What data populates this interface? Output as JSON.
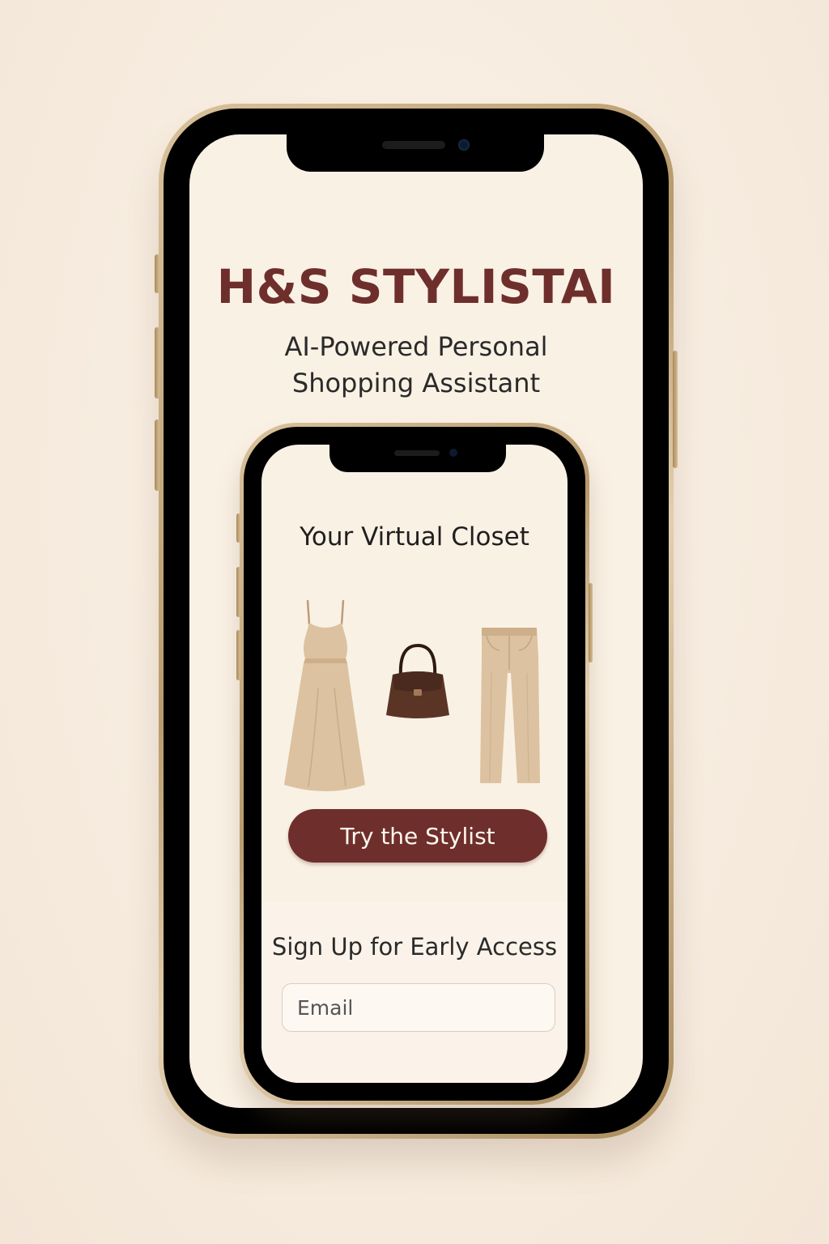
{
  "app": {
    "brand_title": "H&S STYLISTAI",
    "subtitle_line1": "AI-Powered Personal",
    "subtitle_line2": "Shopping Assistant"
  },
  "inner_screen": {
    "closet_title": "Your Virtual Closet",
    "closet_items": [
      {
        "icon": "dress-icon",
        "color": "#dcc2a0"
      },
      {
        "icon": "handbag-icon",
        "color": "#5a3526"
      },
      {
        "icon": "trousers-icon",
        "color": "#dcc2a0"
      }
    ],
    "cta_label": "Try the Stylist",
    "signup_title": "Sign Up for Early Access",
    "email_placeholder": "Email"
  },
  "colors": {
    "brand": "#6e2f2c",
    "background": "#f7ede1",
    "frame_gold": "#c8ab7e"
  }
}
